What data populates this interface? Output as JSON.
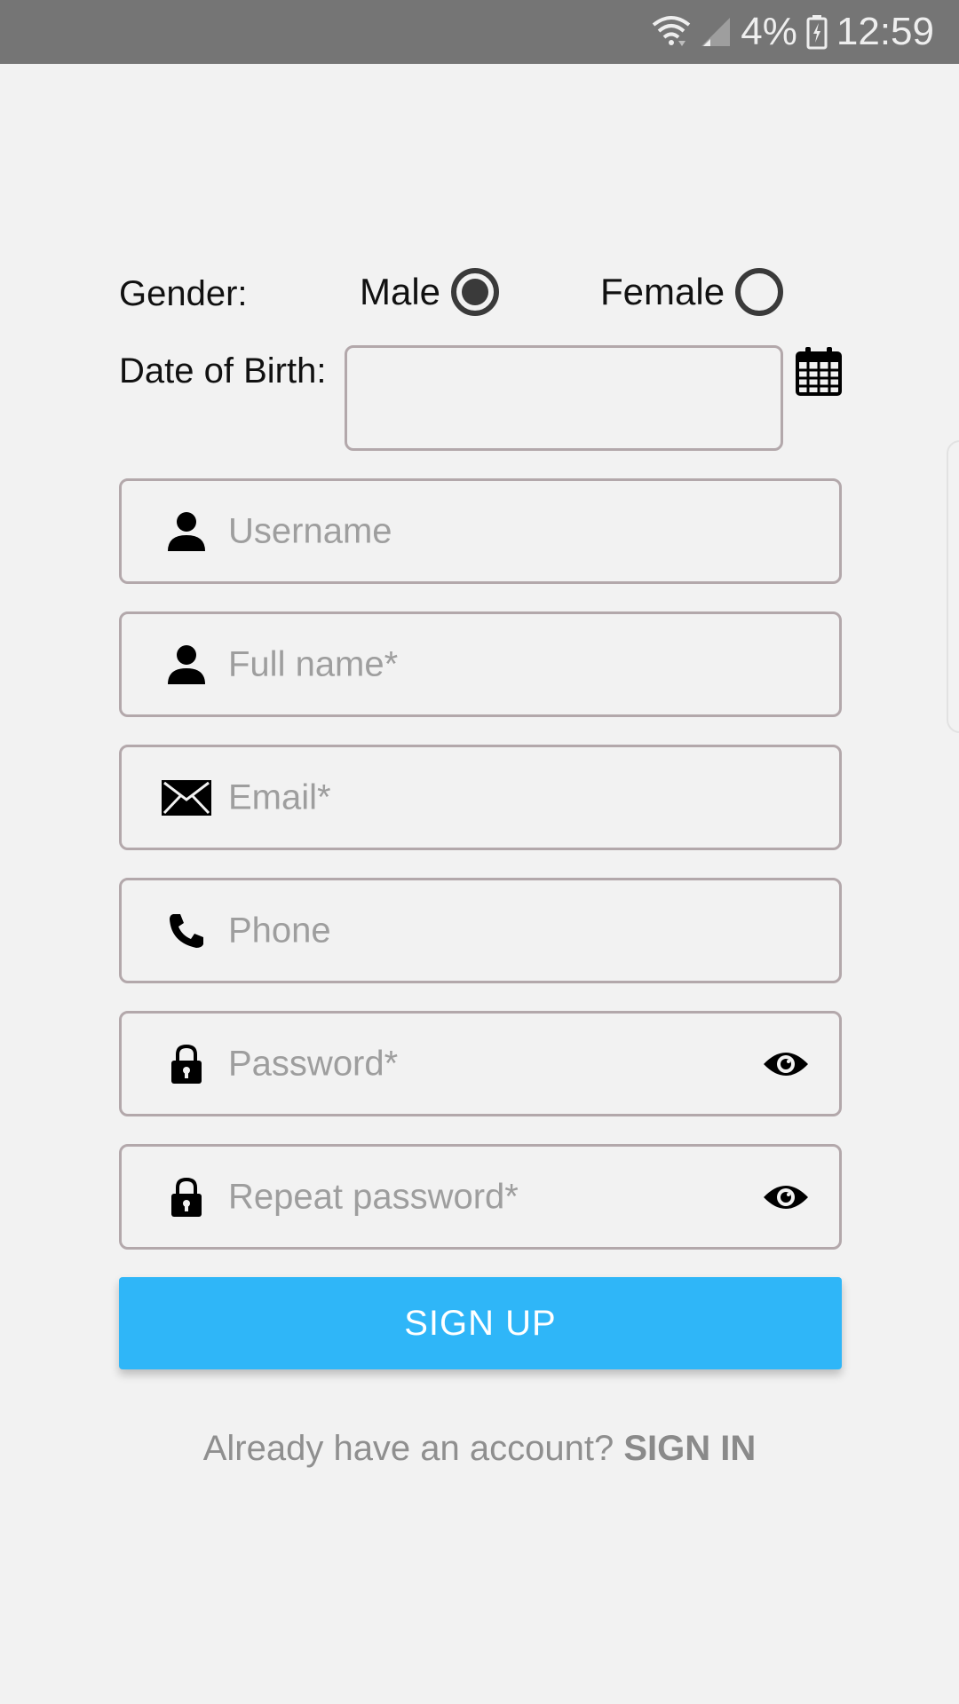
{
  "status_bar": {
    "battery_percent": "4%",
    "time": "12:59",
    "icons": [
      "wifi-icon",
      "signal-icon",
      "battery-icon"
    ]
  },
  "form": {
    "gender_label": "Gender:",
    "gender_options": [
      {
        "label": "Male",
        "selected": true
      },
      {
        "label": "Female",
        "selected": false
      }
    ],
    "dob_label": "Date of Birth:",
    "dob_value": "",
    "fields": {
      "username": {
        "placeholder": "Username",
        "icon": "person-icon"
      },
      "full_name": {
        "placeholder": "Full name*",
        "icon": "person-icon"
      },
      "email": {
        "placeholder": "Email*",
        "icon": "mail-icon"
      },
      "phone": {
        "placeholder": "Phone",
        "icon": "phone-icon"
      },
      "password": {
        "placeholder": "Password*",
        "icon": "lock-icon"
      },
      "repeat_password": {
        "placeholder": "Repeat password*",
        "icon": "lock-icon"
      }
    },
    "signup_label": "SIGN UP",
    "signin_prompt": "Already have an account?",
    "signin_label": "SIGN IN"
  },
  "colors": {
    "status_bar": "#757575",
    "background": "#f2f2f2",
    "accent": "#2fb6f8",
    "field_border": "#b3a8ab",
    "placeholder": "#9e9e9e"
  }
}
